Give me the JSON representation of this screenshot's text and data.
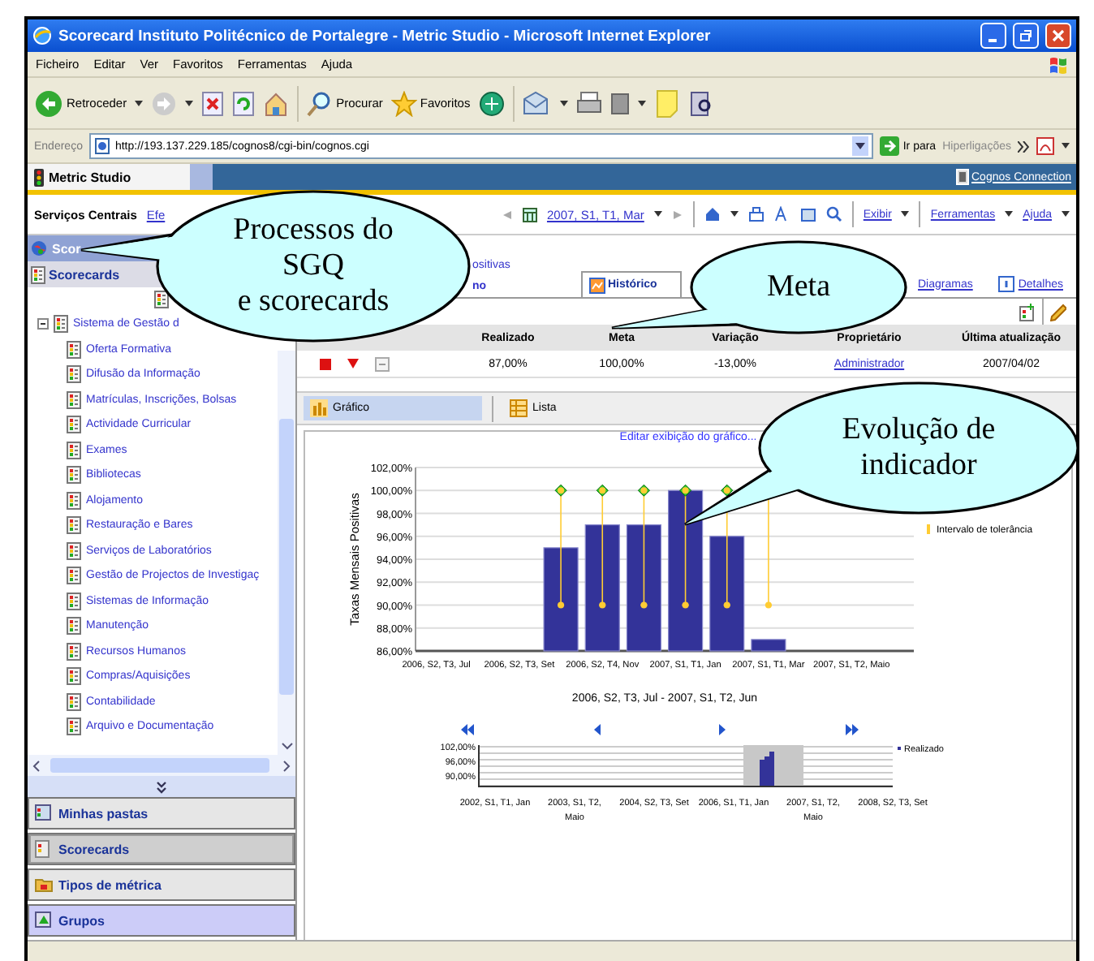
{
  "window": {
    "title": "Scorecard Instituto Politécnico de Portalegre - Metric Studio - Microsoft Internet Explorer"
  },
  "menu": [
    "Ficheiro",
    "Editar",
    "Ver",
    "Favoritos",
    "Ferramentas",
    "Ajuda"
  ],
  "toolbar": {
    "back": "Retroceder",
    "search": "Procurar",
    "favorites": "Favoritos"
  },
  "address_bar": {
    "label": "Endereço",
    "value": "http://193.137.229.185/cognos8/cgi-bin/cognos.cgi",
    "go": "Ir para",
    "links": "Hiperligações"
  },
  "app_bar": {
    "title": "Metric Studio",
    "link": "Cognos Connection"
  },
  "services_bar": {
    "title": "Serviços Centrais",
    "link": "Efe",
    "period": "2007, S1, T1, Mar",
    "menus": [
      "Exibir",
      "Ferramentas",
      "Ajuda"
    ]
  },
  "sidebar": {
    "header": "Scor",
    "section": "Scorecards",
    "tree": [
      {
        "label": "Sistema de Gestão d",
        "expanded": true,
        "children": [
          {
            "label": "Oferta Formativa"
          },
          {
            "label": "Difusão da Informação"
          },
          {
            "label": "Matrículas, Inscrições, Bolsas"
          },
          {
            "label": "Actividade Curricular"
          },
          {
            "label": "Exames"
          },
          {
            "label": "Bibliotecas"
          },
          {
            "label": "Alojamento"
          },
          {
            "label": "Restauração e Bares"
          },
          {
            "label": "Serviços de Laboratórios"
          },
          {
            "label": "Gestão de Projectos de Investigaç"
          },
          {
            "label": "Sistemas de Informação"
          },
          {
            "label": "Manutenção"
          },
          {
            "label": "Recursos Humanos"
          },
          {
            "label": "Compras/Aquisições"
          },
          {
            "label": "Contabilidade"
          },
          {
            "label": "Arquivo e Documentação"
          }
        ]
      }
    ],
    "panels": [
      {
        "label": "Minhas pastas",
        "selected": false,
        "highlighted": false
      },
      {
        "label": "Scorecards",
        "selected": true,
        "highlighted": false
      },
      {
        "label": "Tipos de métrica",
        "selected": false,
        "highlighted": false
      },
      {
        "label": "Grupos",
        "selected": false,
        "highlighted": true
      }
    ]
  },
  "metric": {
    "name": "ositivas",
    "subtitle": "no",
    "tabs": [
      {
        "label": "Histórico",
        "selected": true
      },
      {
        "label": "Diagramas",
        "selected": false
      },
      {
        "label": "Detalhes",
        "selected": false
      }
    ],
    "table": {
      "columns": [
        "Realizado",
        "Meta",
        "Variação",
        "Proprietário",
        "Última atualização"
      ],
      "row": {
        "alert": true,
        "trend_down": true,
        "cells": [
          "87,00%",
          "100,00%",
          "-13,00%",
          "Administrador",
          "2007/04/02"
        ]
      }
    },
    "views": [
      {
        "label": "Gráfico",
        "selected": true
      },
      {
        "label": "Lista",
        "selected": false
      }
    ],
    "chart_link": "Editar exibição do gráfico...",
    "chart_data": {
      "type": "bar",
      "xlabel": "2006, S2, T3, Jul - 2007, S1, T2, Jun",
      "ylabel": "Taxas Mensais Positivas",
      "categories": [
        "2006, S2, T3, Jul",
        null,
        "2006, S2, T3, Set",
        null,
        "2006, S2, T4, Nov",
        null,
        "2007, S1, T1, Jan",
        null,
        "2007, S1, T1, Mar",
        null,
        "2007, S1, T2, Maio",
        null
      ],
      "ylim": [
        86,
        102
      ],
      "yticks": [
        {
          "value": 86,
          "label": "86,00%"
        },
        {
          "value": 88,
          "label": "88,00%"
        },
        {
          "value": 90,
          "label": "90,00%"
        },
        {
          "value": 92,
          "label": "92,00%"
        },
        {
          "value": 94,
          "label": "94,00%"
        },
        {
          "value": 96,
          "label": "96,00%"
        },
        {
          "value": 98,
          "label": "98,00%"
        },
        {
          "value": 100,
          "label": "100,00%"
        },
        {
          "value": 102,
          "label": "102,00%"
        }
      ],
      "series": [
        {
          "type": "bar",
          "color": "#333399",
          "values": [
            null,
            null,
            null,
            95,
            97,
            97,
            100,
            96,
            87,
            null,
            null,
            null
          ]
        },
        {
          "type": "scatter",
          "color": "#33cc33",
          "values": [
            null,
            null,
            null,
            100,
            100,
            100,
            100,
            100,
            null,
            null,
            null,
            null
          ]
        },
        {
          "type": "scatter",
          "name": "Intervalo de tolerância",
          "color": "#ffcc33",
          "values": [
            null,
            null,
            null,
            100,
            100,
            100,
            100,
            100,
            null,
            null,
            null,
            null
          ]
        },
        {
          "type": "scatter",
          "color": "#ffcc33",
          "values": [
            null,
            null,
            null,
            90,
            90,
            90,
            90,
            90,
            90,
            null,
            null,
            null
          ]
        }
      ],
      "grid": true
    },
    "navigator": {
      "legend": "Realizado",
      "y_labels": [
        "102,00%",
        "96,00%",
        "90,00%"
      ],
      "x_labels": [
        "2002, S1, T1, Jan",
        "2003, S1, T2, Maio",
        "2004, S2, T3, Set",
        "2006, S1, T1, Jan",
        "2007, S1, T2, Maio",
        "2008, S2, T3, Set"
      ]
    }
  },
  "callouts": [
    {
      "lines": [
        "Processos do",
        "SGQ",
        "e scorecards"
      ]
    },
    {
      "lines": [
        "Meta"
      ]
    },
    {
      "lines": [
        "Evolução de",
        "indicador"
      ]
    }
  ]
}
